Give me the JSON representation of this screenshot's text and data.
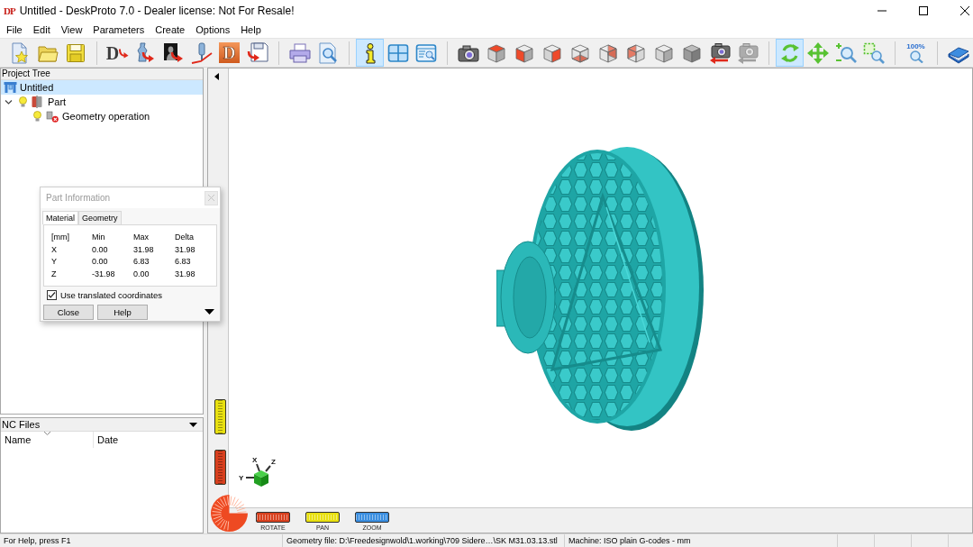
{
  "window": {
    "logo": "DP",
    "title": "Untitled - DeskProto 7.0 - Dealer license: Not For Resale!"
  },
  "menu": [
    "File",
    "Edit",
    "View",
    "Parameters",
    "Create",
    "Options",
    "Help"
  ],
  "toolbar": [
    [
      {
        "kind": "new",
        "selected": false,
        "disabled": false
      },
      {
        "kind": "open",
        "selected": false,
        "disabled": false
      },
      {
        "kind": "save",
        "selected": false,
        "disabled": false
      }
    ],
    [
      {
        "kind": "importpart",
        "label": "D",
        "selected": false,
        "disabled": false
      },
      {
        "kind": "vase",
        "selected": false,
        "disabled": false
      },
      {
        "kind": "relief",
        "selected": false,
        "disabled": false
      },
      {
        "kind": "toolpath",
        "selected": false,
        "disabled": false
      },
      {
        "kind": "lettertile",
        "label": "D",
        "selected": false,
        "disabled": false
      },
      {
        "kind": "export",
        "selected": false,
        "disabled": false
      }
    ],
    [
      {
        "kind": "print",
        "selected": false,
        "disabled": false
      },
      {
        "kind": "preview",
        "selected": false,
        "disabled": false
      }
    ],
    [
      {
        "kind": "info",
        "selected": true,
        "disabled": false
      },
      {
        "kind": "panes",
        "selected": false,
        "disabled": false
      },
      {
        "kind": "zoomlist",
        "selected": false,
        "disabled": false
      }
    ],
    [
      {
        "kind": "camera",
        "selected": false,
        "disabled": false
      },
      {
        "kind": "cubetop",
        "selected": false,
        "disabled": false
      },
      {
        "kind": "cubefront",
        "selected": false,
        "disabled": false
      },
      {
        "kind": "cuberight",
        "selected": false,
        "disabled": false
      },
      {
        "kind": "cubebottom",
        "selected": false,
        "disabled": false
      },
      {
        "kind": "cubeback",
        "selected": false,
        "disabled": false
      },
      {
        "kind": "cubeleft",
        "selected": false,
        "disabled": false
      },
      {
        "kind": "cubeiso",
        "selected": false,
        "disabled": false
      },
      {
        "kind": "cubedimetric",
        "selected": false,
        "disabled": false
      },
      {
        "kind": "restore",
        "selected": false,
        "disabled": false
      },
      {
        "kind": "restore",
        "selected": false,
        "disabled": true
      }
    ],
    [
      {
        "kind": "rotate",
        "selected": true,
        "disabled": false
      },
      {
        "kind": "pan",
        "selected": false,
        "disabled": false
      },
      {
        "kind": "zoom",
        "selected": false,
        "disabled": false
      },
      {
        "kind": "zoomwindow",
        "selected": false,
        "disabled": false
      }
    ],
    [
      {
        "kind": "zoomall",
        "label": "100%",
        "selected": false,
        "disabled": false
      }
    ],
    [
      {
        "kind": "help",
        "selected": false,
        "disabled": false
      }
    ]
  ],
  "project_tree": {
    "title": "Project Tree",
    "items": [
      {
        "kind": "project",
        "label": "Untitled",
        "selected": true,
        "children": [
          {
            "kind": "part",
            "label": "Part",
            "selected": false,
            "expanded": true,
            "visible": true,
            "children": [
              {
                "kind": "operation",
                "label": "Geometry operation",
                "selected": false,
                "visible": true,
                "calculated": false
              }
            ]
          }
        ]
      }
    ]
  },
  "nc_files": {
    "title": "NC Files",
    "columns": [
      {
        "label": "Name",
        "sorted": true
      },
      {
        "label": "Date",
        "sorted": false
      }
    ]
  },
  "part_information": {
    "title": "Part Information",
    "active": false,
    "tabs": [
      {
        "label": "Material",
        "selected": true
      },
      {
        "label": "Geometry",
        "selected": false
      }
    ],
    "columns": [
      "[mm]",
      "Min",
      "Max",
      "Delta"
    ],
    "rows": [
      [
        "X",
        "0.00",
        "31.98",
        "31.98"
      ],
      [
        "Y",
        "0.00",
        "6.83",
        "6.83"
      ],
      [
        "Z",
        "-31.98",
        "0.00",
        "31.98"
      ]
    ],
    "option": {
      "label": "Use translated coordinates",
      "checked": true
    },
    "buttons": [
      "Close",
      "Help"
    ]
  },
  "viewport": {
    "axes": {
      "x": "X",
      "y": "Y",
      "z": "Z"
    },
    "side_wheels": [
      {
        "color": "#e8e010"
      },
      {
        "color": "#d8401e"
      }
    ],
    "dial": {
      "color": "#ee4a22"
    },
    "wheels": [
      {
        "label": "ROTATE",
        "color": "#d8401e"
      },
      {
        "label": "PAN",
        "color": "#e8e010"
      },
      {
        "label": "ZOOM",
        "color": "#3a8ee0"
      }
    ]
  },
  "status_bar": {
    "panes": [
      "For Help, press F1",
      "Geometry file: D:\\Freedesignwold\\1.working\\709 Sidere…\\SK M31.03.13.stl",
      "Machine: ISO plain G-codes - mm"
    ]
  }
}
